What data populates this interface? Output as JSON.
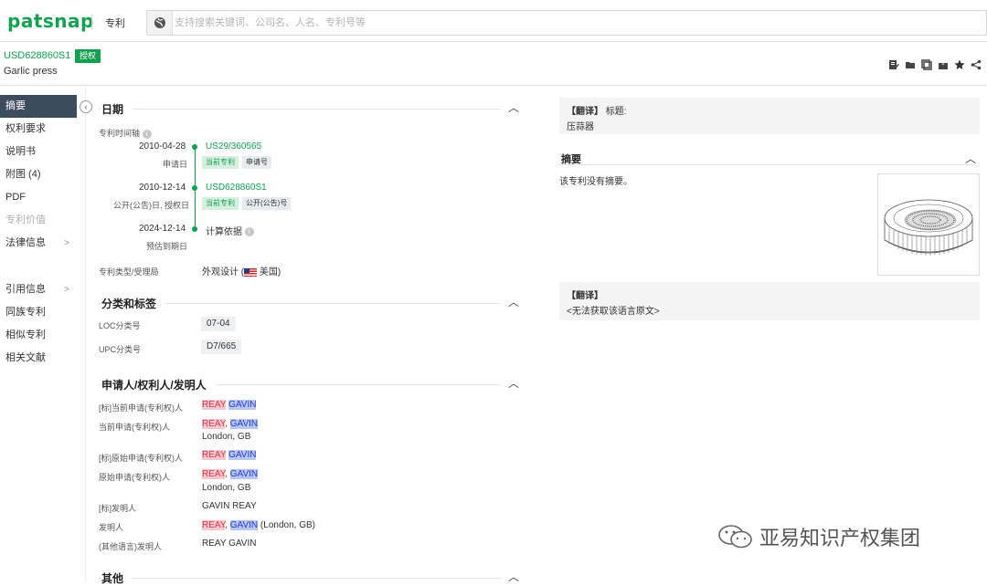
{
  "topbar": {
    "logo": "patsnap",
    "search_type": "专利",
    "search_placeholder": "支持搜索关键词、公司名、人名、专利号等"
  },
  "patent": {
    "number": "USD628860S1",
    "status": "授权",
    "title": "Garlic press"
  },
  "sidebar": {
    "items": [
      {
        "label": "摘要"
      },
      {
        "label": "权利要求"
      },
      {
        "label": "说明书"
      },
      {
        "label": "附图 (4)"
      },
      {
        "label": "PDF"
      },
      {
        "label": "专利价值"
      },
      {
        "label": "法律信息"
      },
      {
        "label": "引用信息"
      },
      {
        "label": "同族专利"
      },
      {
        "label": "相似专利"
      },
      {
        "label": "相关文献"
      }
    ],
    "chevron": ">"
  },
  "dates": {
    "section_title": "日期",
    "timeline_label": "专利时间轴",
    "entries": [
      {
        "date": "2010-04-28",
        "sub": "申请日",
        "number": "US29/360565",
        "tag1": "当前专利",
        "tag2": "申请号"
      },
      {
        "date": "2010-12-14",
        "sub": "公开(公告)日, 授权日",
        "number": "USD628860S1",
        "tag1": "当前专利",
        "tag2": "公开(公告)号"
      },
      {
        "date": "2024-12-14",
        "sub": "预估到期日",
        "number": "计算依据"
      }
    ],
    "type_label": "专利类型/受理局",
    "type_value_pre": "外观设计 (",
    "type_value_post": "美国)"
  },
  "classification": {
    "section_title": "分类和标签",
    "loc_label": "LOC分类号",
    "loc_value": "07-04",
    "upc_label": "UPC分类号",
    "upc_value": "D7/665"
  },
  "people": {
    "section_title": "申请人/权利人/发明人",
    "rows": [
      {
        "label": "[标]当前申请(专利权)人"
      },
      {
        "label": "当前申请(专利权)人",
        "location": "London, GB"
      },
      {
        "label": "[标]原始申请(专利权)人"
      },
      {
        "label": "原始申请(专利权)人",
        "location": "London, GB"
      },
      {
        "label": "[标]发明人",
        "value": "GAVIN REAY"
      },
      {
        "label": "发明人",
        "suffix": " (London, GB)"
      },
      {
        "label": "(其他语言)发明人",
        "value": "REAY GAVIN"
      }
    ],
    "name_reay": "REAY",
    "name_gavin": "GAVIN",
    "comma": ","
  },
  "other": {
    "section_title": "其他"
  },
  "right": {
    "translate_tag": "【翻译】",
    "title_label": "标题:",
    "title_value": "压蒜器",
    "abstract_title": "摘要",
    "abstract_text": "该专利没有摘要。",
    "translate2_tag": "【翻译】",
    "translate2_text": "<无法获取该语言原文>"
  },
  "watermark": "亚易知识产权集团",
  "icons": {
    "toolbar": [
      "edit-note-icon",
      "folder-icon",
      "copy-icon",
      "export-icon",
      "star-icon",
      "share-icon"
    ]
  },
  "colors": {
    "brand_green": "#12a150",
    "sidebar_active": "#3d4b5e"
  }
}
